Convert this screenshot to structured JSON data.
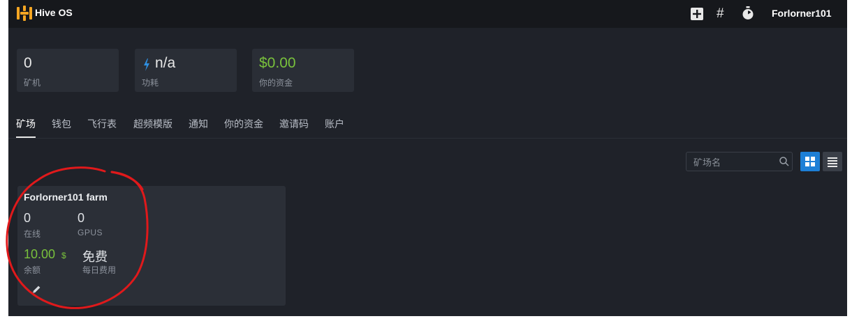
{
  "header": {
    "brand": "Hive OS",
    "icons": [
      "plus-square-icon",
      "hash-icon",
      "stopwatch-icon"
    ],
    "hash_glyph": "#",
    "username": "Forlorner101"
  },
  "stats": [
    {
      "value": "0",
      "label": "矿机"
    },
    {
      "value": "n/a",
      "label": "功耗"
    },
    {
      "value": "$0.00",
      "label": "你的资金"
    }
  ],
  "tabs": [
    {
      "label": "矿场",
      "active": true
    },
    {
      "label": "钱包"
    },
    {
      "label": "飞行表"
    },
    {
      "label": "超频模版"
    },
    {
      "label": "通知"
    },
    {
      "label": "你的资金"
    },
    {
      "label": "邀请码"
    },
    {
      "label": "账户"
    }
  ],
  "search": {
    "placeholder": "矿场名"
  },
  "farm": {
    "name": "Forlorner101 farm",
    "online_value": "0",
    "online_label": "在线",
    "gpus_value": "0",
    "gpus_label": "GPUS",
    "balance_value": "10.00",
    "balance_currency": "$",
    "balance_label": "余额",
    "daily_cost_value": "免费",
    "daily_cost_label": "每日费用"
  },
  "colors": {
    "accent_blue": "#1d7fd6",
    "balance_green": "#79c13c",
    "logo_orange": "#f5a623",
    "annotation_red": "#e0191b"
  }
}
